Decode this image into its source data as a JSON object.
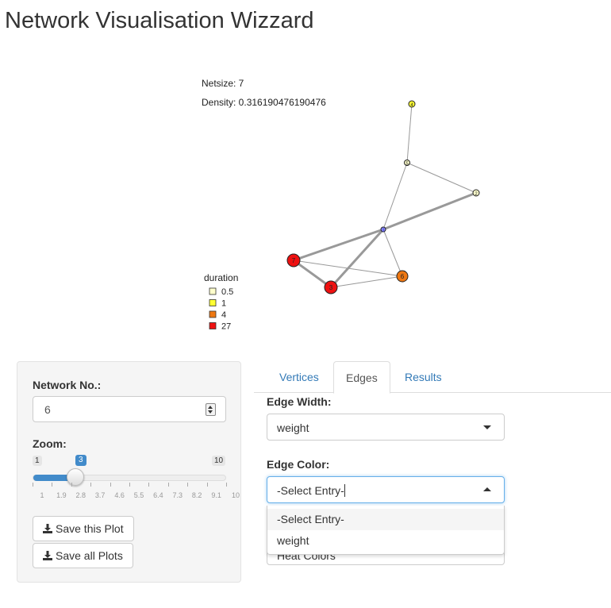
{
  "app": {
    "title": "Network Visualisation Wizzard"
  },
  "network_info": {
    "netsize": "Netsize: 7",
    "density": "Density: 0.316190476190476"
  },
  "graph": {
    "legend": {
      "title": "duration",
      "items": [
        {
          "label": "0.5",
          "color": "#ffffcc"
        },
        {
          "label": "1",
          "color": "#ffff33"
        },
        {
          "label": "4",
          "color": "#ee7711"
        },
        {
          "label": "27",
          "color": "#ee1111"
        }
      ]
    },
    "nodes": [
      {
        "id": "1",
        "color": "#8888ff"
      },
      {
        "id": "2",
        "color": "#ffffcc"
      },
      {
        "id": "3",
        "color": "#ee1111"
      },
      {
        "id": "4",
        "color": "#ffff33"
      },
      {
        "id": "5",
        "color": "#ffffcc"
      },
      {
        "id": "6",
        "color": "#ee7711"
      },
      {
        "id": "7",
        "color": "#ee1111"
      }
    ],
    "edges": [
      {
        "from": "4",
        "to": "5"
      },
      {
        "from": "5",
        "to": "2"
      },
      {
        "from": "5",
        "to": "1"
      },
      {
        "from": "2",
        "to": "1"
      },
      {
        "from": "1",
        "to": "7"
      },
      {
        "from": "1",
        "to": "3"
      },
      {
        "from": "1",
        "to": "6"
      },
      {
        "from": "7",
        "to": "3"
      },
      {
        "from": "7",
        "to": "6"
      },
      {
        "from": "3",
        "to": "6"
      }
    ]
  },
  "sidebar": {
    "network_label": "Network No.:",
    "network_value": "6",
    "zoom_label": "Zoom:",
    "zoom": {
      "min": "1",
      "max": "10",
      "value": "3",
      "ticks": [
        "1",
        "1.9",
        "2.8",
        "3.7",
        "4.6",
        "5.5",
        "6.4",
        "7.3",
        "8.2",
        "9.1",
        "10"
      ]
    },
    "save_plot": "Save this Plot",
    "save_all": "Save all Plots"
  },
  "tabs": [
    {
      "label": "Vertices",
      "active": false
    },
    {
      "label": "Edges",
      "active": true
    },
    {
      "label": "Results",
      "active": false
    }
  ],
  "edges_tab": {
    "width_label": "Edge Width:",
    "width_value": "weight",
    "color_label": "Edge Color:",
    "color_value": "-Select Entry-",
    "options": [
      "-Select Entry-",
      "weight"
    ],
    "hidden_field_text": "Heat Colors"
  }
}
